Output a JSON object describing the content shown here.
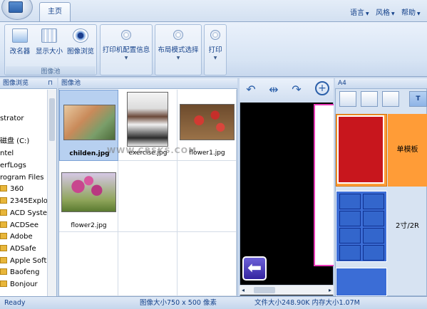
{
  "app": {
    "home_tab": "主页"
  },
  "menu": [
    "语言",
    "风格",
    "帮助"
  ],
  "ribbon": {
    "group_label": "图像池",
    "buttons": [
      "改名器",
      "显示大小",
      "图像浏览"
    ],
    "dropdowns": [
      "打印机配置信息",
      "布局模式选择",
      "打印"
    ]
  },
  "tree": {
    "header": "图像浏览",
    "pin": "ᵖ",
    "items": [
      "strator",
      "磁盘 (C:)",
      "ntel",
      "erfLogs",
      "rogram Files",
      "360",
      "2345Explo",
      "ACD Syste",
      "ACDSee",
      "Adobe",
      "ADSafe",
      "Apple Soft",
      "Baofeng",
      "Bonjour"
    ]
  },
  "grid": {
    "header": "图像池",
    "images": [
      {
        "name": "childen.jpg",
        "selected": true
      },
      {
        "name": "exercise.jpg",
        "selected": false
      },
      {
        "name": "flower1.jpg",
        "selected": false
      },
      {
        "name": "flower2.jpg",
        "selected": false
      }
    ],
    "watermark": "WWW.CBSKS.COM"
  },
  "layouts": {
    "paper": "A4",
    "templates": [
      {
        "label": "单模板",
        "selected": true
      },
      {
        "label": "2寸/2R",
        "selected": false
      }
    ]
  },
  "status": {
    "ready": "Ready",
    "image_size": "图像大小750 x 500 像素",
    "file_size": "文件大小248.90K 内存大小1.07M"
  },
  "colors": {
    "accent": "#3b6dd6",
    "selected_template": "#ff9c37",
    "frame": "#e83ab8"
  }
}
